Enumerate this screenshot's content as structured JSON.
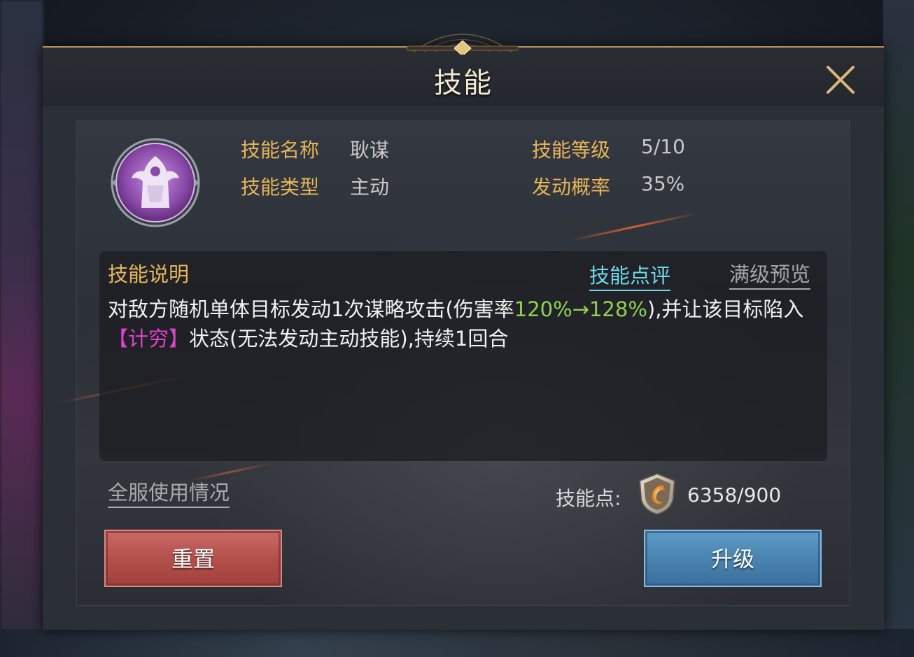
{
  "dialog": {
    "title": "技能",
    "close_icon": "close-icon"
  },
  "skill": {
    "icon": "purple-skill-emblem-icon",
    "name_label": "技能名称",
    "name_value": "耿谋",
    "type_label": "技能类型",
    "type_value": "主动",
    "level_label": "技能等级",
    "level_value": "5/10",
    "chance_label": "发动概率",
    "chance_value": "35%"
  },
  "description": {
    "title": "技能说明",
    "tab_review": "技能点评",
    "tab_full_preview": "满级预览",
    "text_part1": "对敌方随机单体目标发动1次谋略攻击(伤害率",
    "text_rate": "120%→128%",
    "text_part2": "),并让该目标陷入",
    "text_status": "【计穷】",
    "text_part3": "状态(无法发动主动技能),持续1回合"
  },
  "footer": {
    "server_usage_link": "全服使用情况",
    "points_label": "技能点:",
    "points_icon": "skill-point-shield-icon",
    "points_value": "6358/900",
    "reset_button": "重置",
    "upgrade_button": "升级"
  },
  "colors": {
    "gold_label": "#e6b45a",
    "cyan_tab": "#6fd8e8",
    "green_highlight": "#8fd14f",
    "magenta_highlight": "#e43fcf",
    "reset_red": "#b4504c",
    "upgrade_blue": "#4a84b2"
  }
}
